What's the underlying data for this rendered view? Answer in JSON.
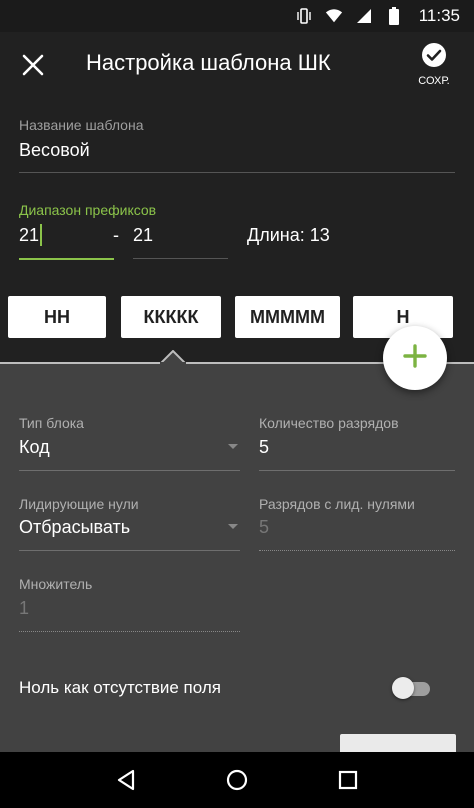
{
  "status_bar": {
    "time": "11:35",
    "icons": [
      "vibrate-icon",
      "wifi-icon",
      "signal-icon",
      "battery-icon"
    ]
  },
  "app_bar": {
    "title": "Настройка шаблона ШК",
    "close_icon": "close-icon",
    "save_label": "СОХР.",
    "save_icon": "check-circle-icon"
  },
  "template_name": {
    "label": "Название шаблона",
    "value": "Весовой"
  },
  "prefix_range": {
    "label": "Диапазон префиксов",
    "from": "21",
    "separator": "-",
    "to": "21",
    "length_text": "Длина: 13"
  },
  "blocks": [
    {
      "label": "НН"
    },
    {
      "label": "ККККК"
    },
    {
      "label": "ММММM"
    },
    {
      "label": "Н"
    }
  ],
  "fab_icon": "add-icon",
  "block_settings": {
    "block_type": {
      "label": "Тип блока",
      "value": "Код"
    },
    "digits_count": {
      "label": "Количество разрядов",
      "value": "5"
    },
    "leading_zeros": {
      "label": "Лидирующие нули",
      "value": "Отбрасывать"
    },
    "digits_with_zeros": {
      "label": "Разрядов с лид. нулями",
      "value": "5"
    },
    "multiplier": {
      "label": "Множитель",
      "value": "1"
    },
    "null_as_absent": {
      "label": "Ноль как отсутствие поля",
      "enabled": false
    }
  },
  "nav_bar": {
    "icons": [
      "back-icon",
      "home-icon",
      "recents-icon"
    ]
  },
  "colors": {
    "accent": "#8bc34a",
    "app_bar": "#212121",
    "panel": "#424242"
  }
}
